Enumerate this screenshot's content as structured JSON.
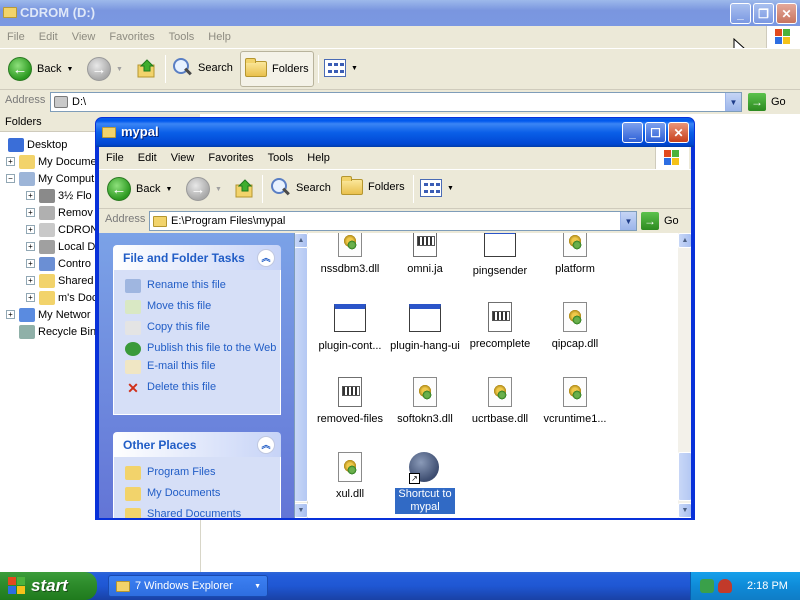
{
  "back_window": {
    "title": "CDROM (D:)",
    "menu": [
      "File",
      "Edit",
      "View",
      "Favorites",
      "Tools",
      "Help"
    ],
    "toolbar": {
      "back": "Back",
      "search": "Search",
      "folders": "Folders"
    },
    "address": {
      "label": "Address",
      "value": "D:\\",
      "go": "Go"
    },
    "tree": {
      "header": "Folders",
      "items": [
        "Desktop",
        "My Docume",
        "My Comput",
        "3½ Flo",
        "Remov",
        "CDRON",
        "Local D",
        "Contro",
        "Shared",
        "m's Doc",
        "My Networ",
        "Recycle Bin"
      ]
    }
  },
  "front_window": {
    "title": "mypal",
    "menu": [
      "File",
      "Edit",
      "View",
      "Favorites",
      "Tools",
      "Help"
    ],
    "toolbar": {
      "back": "Back",
      "search": "Search",
      "folders": "Folders"
    },
    "address": {
      "label": "Address",
      "value": "E:\\Program Files\\mypal",
      "go": "Go"
    },
    "tasks": {
      "title": "File and Folder Tasks",
      "links": [
        "Rename this file",
        "Move this file",
        "Copy this file",
        "Publish this file to the Web",
        "E-mail this file",
        "Delete this file"
      ]
    },
    "places": {
      "title": "Other Places",
      "links": [
        "Program Files",
        "My Documents",
        "Shared Documents"
      ]
    },
    "files": [
      {
        "name": "nssdbm3.dll",
        "icon": "dll-icon"
      },
      {
        "name": "omni.ja",
        "icon": "document-icon"
      },
      {
        "name": "pingsender",
        "icon": "window-icon"
      },
      {
        "name": "platform",
        "icon": "dll-icon"
      },
      {
        "name": "plugin-cont...",
        "icon": "window-icon"
      },
      {
        "name": "plugin-hang-ui",
        "icon": "window-icon"
      },
      {
        "name": "precomplete",
        "icon": "document-icon"
      },
      {
        "name": "qipcap.dll",
        "icon": "dll-icon"
      },
      {
        "name": "removed-files",
        "icon": "document-icon"
      },
      {
        "name": "softokn3.dll",
        "icon": "dll-icon"
      },
      {
        "name": "ucrtbase.dll",
        "icon": "dll-icon"
      },
      {
        "name": "vcruntime1...",
        "icon": "dll-icon"
      },
      {
        "name": "xul.dll",
        "icon": "dll-icon"
      },
      {
        "name": "Shortcut to mypal",
        "icon": "mypal-shortcut-icon",
        "selected": true
      }
    ]
  },
  "taskbar": {
    "start": "start",
    "task_button": "7 Windows Explorer",
    "clock": "2:18 PM"
  },
  "colors": {
    "xp_blue": "#0831d9",
    "task_link": "#215dc6",
    "selection": "#316ac5",
    "start_green": "#2e8d2c"
  }
}
